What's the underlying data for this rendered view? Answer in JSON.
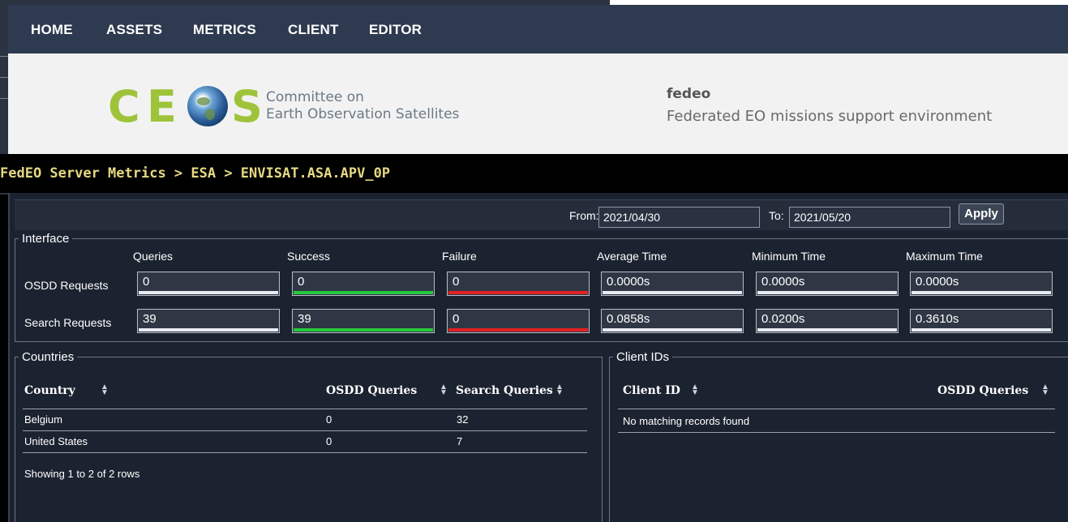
{
  "nav": {
    "items": [
      {
        "label": "HOME"
      },
      {
        "label": "ASSETS"
      },
      {
        "label": "METRICS"
      },
      {
        "label": "CLIENT"
      },
      {
        "label": "EDITOR"
      }
    ]
  },
  "banner": {
    "logo_letters": [
      "C",
      "E",
      "S"
    ],
    "logo_icon": "globe-icon",
    "org_line1": "Committee on",
    "org_line2": "Earth Observation Satellites",
    "app_name": "fedeo",
    "app_subtitle": "Federated EO missions support environment"
  },
  "breadcrumb": "FedEO Server Metrics > ESA > ENVISAT.ASA.APV_0P",
  "filter": {
    "from_label": "From:",
    "from_value": "2021/04/30",
    "to_label": "To:",
    "to_value": "2021/05/20",
    "apply_label": "Apply"
  },
  "interface": {
    "legend": "Interface",
    "columns": [
      "Queries",
      "Success",
      "Failure",
      "Average Time",
      "Minimum Time",
      "Maximum Time"
    ],
    "rows": [
      {
        "label": "OSDD Requests",
        "values": [
          "0",
          "0",
          "0",
          "0.0000s",
          "0.0000s",
          "0.0000s"
        ]
      },
      {
        "label": "Search Requests",
        "values": [
          "39",
          "39",
          "0",
          "0.0858s",
          "0.0200s",
          "0.3610s"
        ]
      }
    ],
    "colors": {
      "success": "#25c93c",
      "failure": "#e32124",
      "neutral": "#e8ecf2"
    }
  },
  "countries": {
    "legend": "Countries",
    "headers": [
      "Country",
      "OSDD Queries",
      "Search Queries"
    ],
    "rows": [
      [
        "Belgium",
        "0",
        "32"
      ],
      [
        "United States",
        "0",
        "7"
      ]
    ],
    "footer": "Showing 1 to 2 of 2 rows"
  },
  "clients": {
    "legend": "Client IDs",
    "headers": [
      "Client ID",
      "OSDD Queries"
    ],
    "empty_message": "No matching records found"
  },
  "colors": {
    "nav_bg": "#2e3a4f",
    "panel_bg": "#1c2330",
    "breadcrumb": "#e6d983",
    "logo_green": "#9ec33a"
  }
}
